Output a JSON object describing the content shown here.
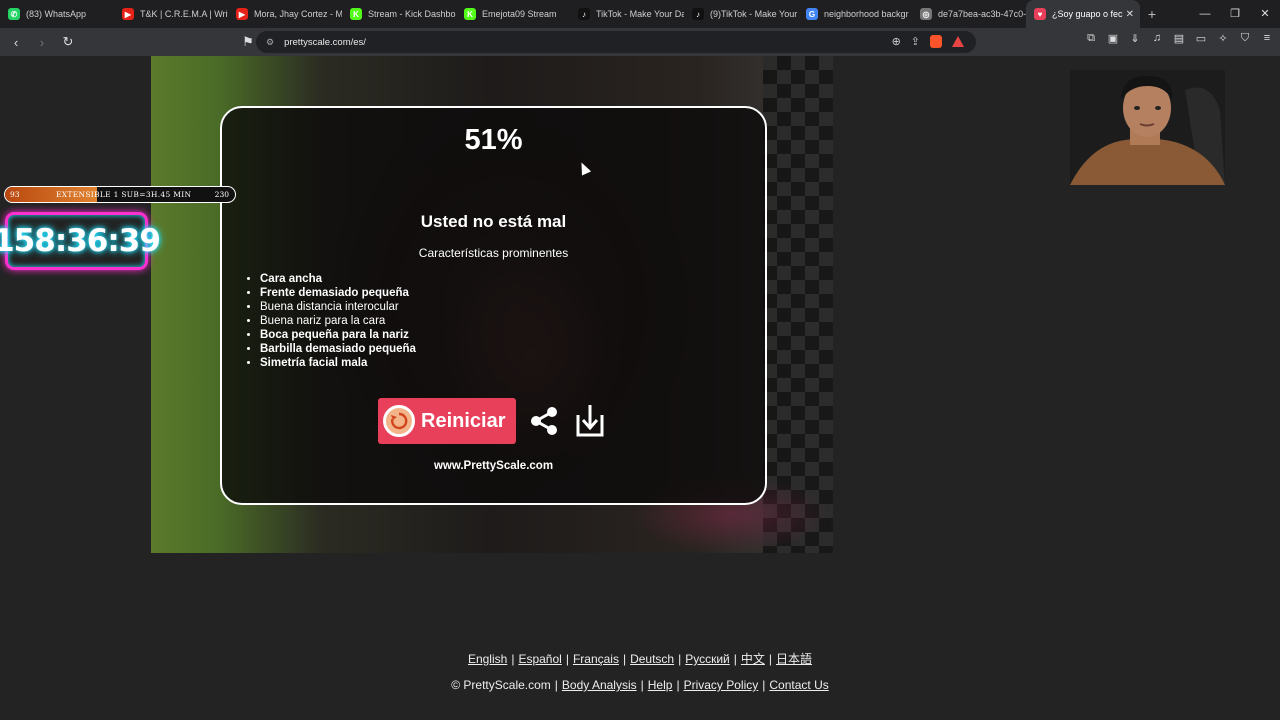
{
  "browser": {
    "tabs": [
      {
        "label": "(83) WhatsApp",
        "icon_color": "#25d366",
        "icon_glyph": "✆"
      },
      {
        "label": "T&K | C.R.E.M.A | Writ",
        "icon_color": "#e62117",
        "icon_glyph": "▶"
      },
      {
        "label": "Mora, Jhay Cortez - M",
        "icon_color": "#e62117",
        "icon_glyph": "▶"
      },
      {
        "label": "Stream - Kick Dashboa",
        "icon_color": "#53fc18",
        "icon_glyph": "K"
      },
      {
        "label": "Emejota09 Stream",
        "icon_color": "#53fc18",
        "icon_glyph": "K"
      },
      {
        "label": "TikTok - Make Your Da",
        "icon_color": "#111111",
        "icon_glyph": "♪"
      },
      {
        "label": "(9)TikTok - Make Your",
        "icon_color": "#111111",
        "icon_glyph": "♪"
      },
      {
        "label": "neighborhood backgr",
        "icon_color": "#4285f4",
        "icon_glyph": "G"
      },
      {
        "label": "de7a7bea-ac3b-47c0-",
        "icon_color": "#777777",
        "icon_glyph": "◎"
      },
      {
        "label": "¿Soy guapo o fec",
        "icon_color": "#e8405a",
        "icon_glyph": "♥",
        "active": true
      }
    ],
    "url": "prettyscale.com/es/"
  },
  "stream_overlay": {
    "sub_count": "93",
    "sub_goal_text": "EXTENSIBLE 1 SUB=3H.45 MIN",
    "sub_goal_target": "230",
    "sub_progress": 0.4,
    "timer": "158:36:39"
  },
  "result": {
    "percent": "51%",
    "verdict": "Usted no está mal",
    "features_title": "Características prominentes",
    "features": [
      {
        "text": "Cara ancha",
        "bold": true
      },
      {
        "text": "Frente demasiado pequeña",
        "bold": true
      },
      {
        "text": "Buena distancia interocular",
        "bold": false
      },
      {
        "text": "Buena nariz para la cara",
        "bold": false
      },
      {
        "text": "Boca pequeña para la nariz",
        "bold": true
      },
      {
        "text": "Barbilla demasiado pequeña",
        "bold": true
      },
      {
        "text": "Simetría facial mala",
        "bold": true
      }
    ],
    "restart_label": "Reiniciar",
    "site": "www.PrettyScale.com"
  },
  "footer": {
    "languages": [
      "English",
      "Español",
      "Français",
      "Deutsch",
      "Русский",
      "中文",
      "日本語"
    ],
    "copyright": "© PrettyScale.com",
    "links": [
      "Body Analysis",
      "Help",
      "Privacy Policy",
      "Contact Us"
    ]
  },
  "colors": {
    "accent": "#e8405a",
    "timer_border": "#ff2fd0",
    "timer_glow": "#23e0ff"
  }
}
